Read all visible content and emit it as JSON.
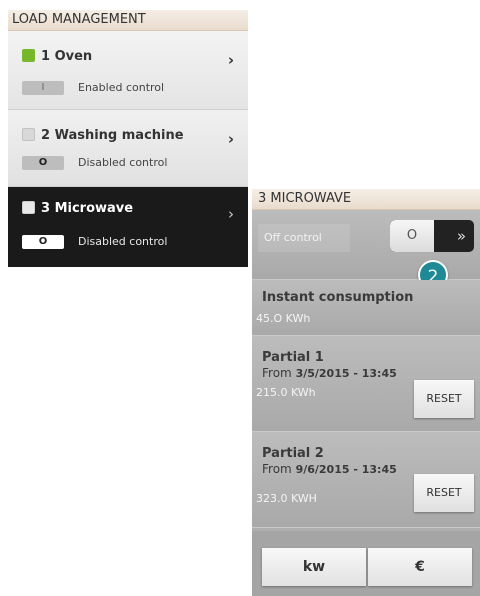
{
  "load_management": {
    "title": "LOAD MANAGEMENT",
    "items": [
      {
        "name": "1 Oven",
        "status_color": "#76b82a",
        "toggle": "I",
        "control": "Enabled control"
      },
      {
        "name": "2 Washing machine",
        "status_color": "#d8d8d8",
        "toggle": "O",
        "control": "Disabled control"
      },
      {
        "name": "3 Microwave",
        "status_color": "#e9e9e9",
        "toggle": "O",
        "control": "Disabled control"
      }
    ],
    "chevron": "›"
  },
  "microwave": {
    "title": "3 MICROWAVE",
    "off_control": "Off control",
    "switch_label": "O",
    "switch_arrows": "»",
    "badge": "2",
    "instant": {
      "label": "Instant consumption",
      "value": "45.O KWh"
    },
    "partial1": {
      "label": "Partial 1",
      "from": "From",
      "date": "3/5/2015 - 13:45",
      "value": "215.0 KWh",
      "reset": "RESET"
    },
    "partial2": {
      "label": "Partial 2",
      "from": "From",
      "date": "9/6/2015 - 13:45",
      "value": "323.0 KWH",
      "reset": "RESET"
    },
    "units": {
      "kw": "kw",
      "euro": "€"
    }
  },
  "colors": {
    "accent_badge": "#1f8a96",
    "header_bg": "#efe4d8",
    "selected_bg": "#1a1a1a"
  }
}
